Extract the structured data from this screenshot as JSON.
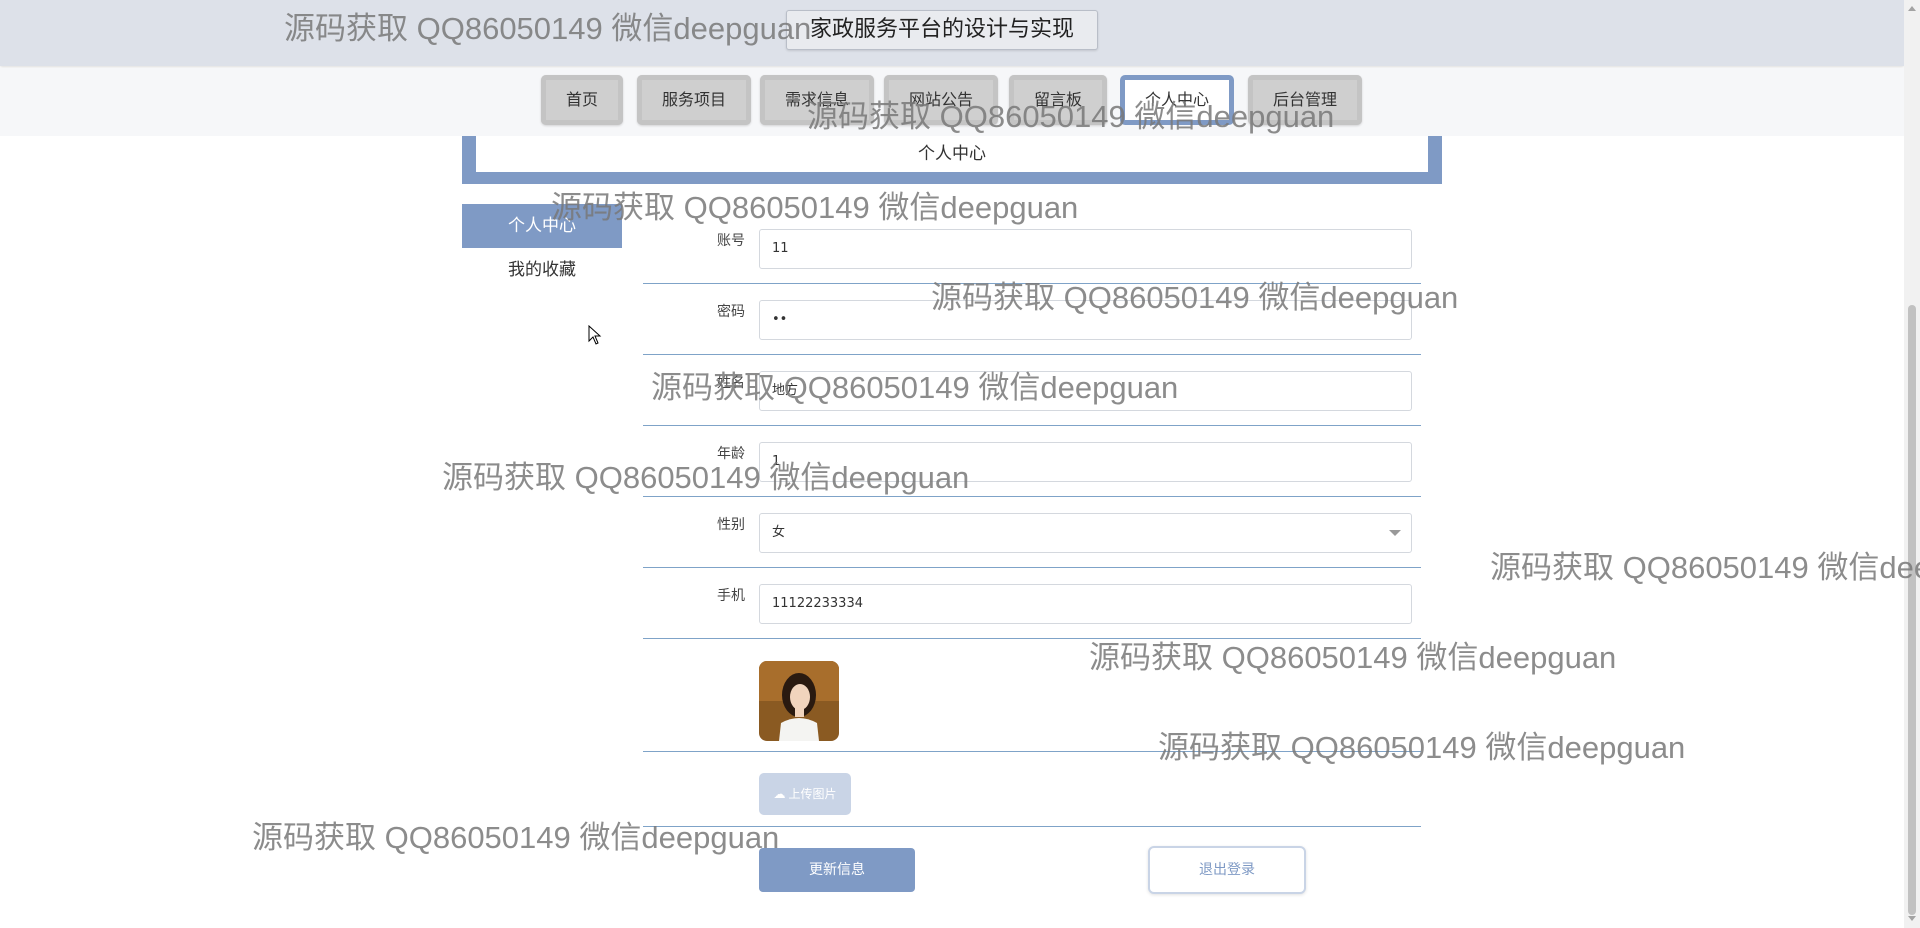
{
  "header": {
    "site_title": "家政服务平台的设计与实现"
  },
  "nav": {
    "items": [
      {
        "label": "首页"
      },
      {
        "label": "服务项目"
      },
      {
        "label": "需求信息"
      },
      {
        "label": "网站公告"
      },
      {
        "label": "留言板"
      },
      {
        "label": "个人中心"
      },
      {
        "label": "后台管理"
      }
    ],
    "active": "个人中心"
  },
  "section": {
    "title": "个人中心"
  },
  "sidebar": {
    "items": [
      {
        "label": "个人中心"
      },
      {
        "label": "我的收藏"
      }
    ],
    "active": "个人中心"
  },
  "form": {
    "account": {
      "label": "账号",
      "value": "11"
    },
    "password": {
      "label": "密码",
      "value": "••"
    },
    "name": {
      "label": "姓名",
      "value": "地方"
    },
    "age": {
      "label": "年龄",
      "value": "1"
    },
    "gender": {
      "label": "性别",
      "value": "女"
    },
    "phone": {
      "label": "手机",
      "value": "11122233334"
    },
    "upload_label": "上传图片",
    "update_button": "更新信息",
    "logout_button": "退出登录"
  },
  "watermark": {
    "text": "源码获取 QQ86050149 微信deepguan"
  },
  "colors": {
    "accent": "#7f9ac5",
    "header_bg": "#dde1e9",
    "upload_bg": "#c9d4e6"
  }
}
